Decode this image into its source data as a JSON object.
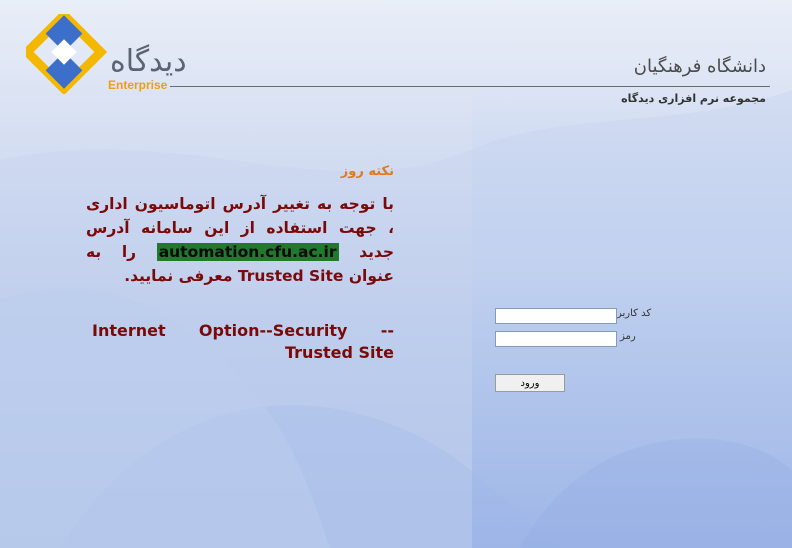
{
  "brand": {
    "logo_text": "دیدگاه",
    "logo_subtitle": "Enterprise"
  },
  "header": {
    "org_name": "دانشگاه فرهنگیان",
    "suite_name": "مجموعه نرم افزاری دیدگاه"
  },
  "tip": {
    "title": "نکته روز",
    "body_part1": "با توجه به تغییر آدرس اتوماسیون اداری ، جهت استفاده از این سامانه آدرس جدید ",
    "url": "automation.cfu.ac.ir",
    "body_part2": " را به عنوان ",
    "trusted_term": "Trusted Site",
    "body_part3": " معرفی نمایید.",
    "path": "Internet Option--Security -- Trusted Site"
  },
  "login": {
    "username_label": "کد کاربر",
    "password_label": "رمز",
    "username_value": "",
    "password_value": "",
    "submit_label": "ورود"
  },
  "colors": {
    "accent_orange": "#e07a1a",
    "tip_text": "#7a0a0a",
    "url_highlight": "#1f7a2e",
    "logo_blue": "#3b6fc9",
    "logo_yellow": "#f5b800"
  }
}
